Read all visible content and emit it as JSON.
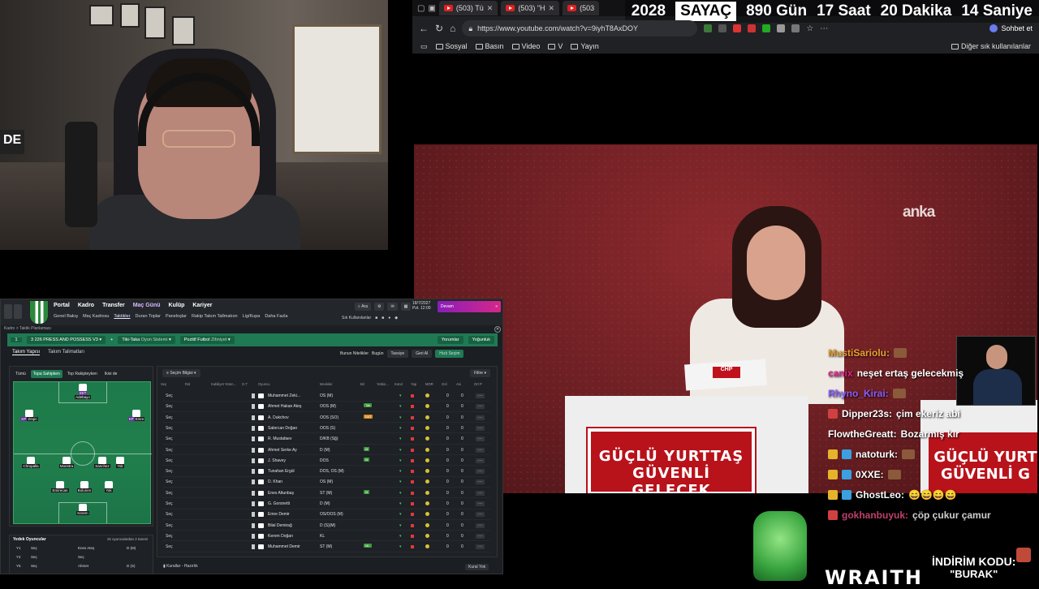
{
  "browser": {
    "tabs": [
      {
        "title": "(503) Tü"
      },
      {
        "title": "(503) \"H"
      },
      {
        "title": "(503"
      }
    ],
    "url": "https://www.youtube.com/watch?v=9iyhT8AxDOY",
    "bookmarks": [
      "Sosyal",
      "Basın",
      "Video",
      "V",
      "Yayın"
    ],
    "other_bookmarks": "Diğer sık kullanılanlar",
    "chat_button": "Sohbet et"
  },
  "counter": {
    "year": "2028",
    "label": "SAYAÇ",
    "days": "890 Gün",
    "hours": "17 Saat",
    "minutes": "20 Dakika",
    "seconds": "14 Saniye"
  },
  "webcam": {
    "corner_text": "DE"
  },
  "video": {
    "watermark": "anka",
    "podium_line1": "GÜÇLÜ YURTTAŞ",
    "podium_line2": "GÜVENLİ GELECEK",
    "podium2_line1": "GÜÇLÜ YURT",
    "podium2_line2": "GÜVENLİ G",
    "paper_logo": "CHP"
  },
  "chat": {
    "messages": [
      {
        "user": "MustiSariolu:",
        "text": "",
        "color": "#e8a030"
      },
      {
        "user": "canix",
        "text": "neşet ertaş gelecekmiş",
        "color": "#e0208a"
      },
      {
        "user": "Rhyno_Kirai:",
        "text": "",
        "color": "#8a5cff"
      },
      {
        "user": "Dipper23s:",
        "text": "çim ekeriz abi",
        "color": "#ffffff"
      },
      {
        "user": "FlowtheGreatt:",
        "text": "Bozarmış kır",
        "color": "#ffffff"
      },
      {
        "user": "natoturk:",
        "text": "",
        "color": "#ffffff"
      },
      {
        "user": "0XXE:",
        "text": "",
        "color": "#ffffff"
      },
      {
        "user": "GhostLeo:",
        "text": "😄😄😄😄",
        "color": "#ffffff"
      },
      {
        "user": "gokhanbuyuk:",
        "text": "çöp çukur çamur",
        "color": "#c0406a"
      }
    ]
  },
  "overlay": {
    "brand": "WRAITH",
    "promo_line": "İNDİRİM KODU:",
    "promo_code": "\"BURAK\""
  },
  "fm": {
    "menu": [
      "Portal",
      "Kadro",
      "Transfer",
      "Maç Günü",
      "Kulüp",
      "Kariyer"
    ],
    "submenu": [
      "Genel Bakış",
      "Maç Kadrosu",
      "Taktikler",
      "Duran Toplar",
      "Paneloşlar",
      "Rakip Takım Tallmatıon",
      "Lig/Kupa",
      "Daha Fazla"
    ],
    "search_btn": "Ara",
    "date_line1": "18/7/2027",
    "date_line2": "Pzt. 12:00",
    "continue_label": "Devam",
    "top_icons": "Sık Kullanılanlar",
    "breadcrumb": "Kadro > Taktik Planlaması",
    "tactic_number": "1",
    "tactic_name": "3 226 PRESS AND POSSESS V3",
    "tactic_style": "Tiki-Taka",
    "tactic_style_sub": "Oyun Sistemi",
    "tactic_mentality": "Pozitif Futbol",
    "tactic_mentality_sub": "Zihniyet",
    "tactic_right1": "Yorumlar",
    "tactic_right2": "Yoğunluk",
    "tabs": [
      "Takım Yapısı",
      "Takım Talimatları"
    ],
    "actions": [
      "Bunun Nitelikler",
      "Bugün",
      "Tavsiye",
      "Geri Al",
      "Hızlı Seçim"
    ],
    "pitch_tabs": [
      "Tümü",
      "Topa Sahipken",
      "Top Rakipteyken",
      "Ikisi de"
    ],
    "players": [
      {
        "name": "Adebayo",
        "role": "SKT"
      },
      {
        "name": "Zeqiri",
        "role": "KP"
      },
      {
        "name": "Emre",
        "role": "KP"
      },
      {
        "name": "Chrupalla",
        "role": ""
      },
      {
        "name": "Moestra",
        "role": ""
      },
      {
        "name": "Sanchez",
        "role": ""
      },
      {
        "name": "Yok",
        "role": ""
      },
      {
        "name": "Emirecan",
        "role": ""
      },
      {
        "name": "Bolunen",
        "role": ""
      },
      {
        "name": "Yok",
        "role": ""
      },
      {
        "name": "Kerem",
        "role": ""
      }
    ],
    "squad_filter": "Seçim Bilgisi",
    "squad_filter_btn": "Filtre",
    "squad_headers": [
      "Seç",
      "Rol",
      "Kabiliyet Yeten...",
      "G.T",
      "Oyuncu",
      "Mevkiler",
      "Bil",
      "Yetkin...",
      "Kond",
      "Yap",
      "MOR",
      "Gol",
      "Asi",
      "Ort P"
    ],
    "rows": [
      {
        "sec": "Seç",
        "name": "Muhammet Zeki...",
        "pos": "OS (M)",
        "tag": "",
        "tagc": "",
        "n1": "0",
        "n2": "0"
      },
      {
        "sec": "Seç",
        "name": "Ahmet Hakan Ateş",
        "pos": "OOS (M)",
        "tag": "Tak",
        "tagc": "#3a9a3a",
        "n1": "0",
        "n2": "0"
      },
      {
        "sec": "Seç",
        "name": "A. Dukchov",
        "pos": "OOS (SO)",
        "tag": "SAT",
        "tagc": "#d28a1a",
        "n1": "0",
        "n2": "0"
      },
      {
        "sec": "Seç",
        "name": "Sabırcan Doğan",
        "pos": "OOS (S)",
        "tag": "",
        "tagc": "",
        "n1": "0",
        "n2": "0"
      },
      {
        "sec": "Seç",
        "name": "R. Mustafaev",
        "pos": "D/KB (Sğ)",
        "tag": "",
        "tagc": "",
        "n1": "0",
        "n2": "0"
      },
      {
        "sec": "Seç",
        "name": "Ahmet Serke Ay",
        "pos": "D (M)",
        "tag": "M",
        "tagc": "#3a9a3a",
        "n1": "0",
        "n2": "0"
      },
      {
        "sec": "Seç",
        "name": "J. Shavey",
        "pos": "DOS",
        "tag": "M",
        "tagc": "#3a9a3a",
        "n1": "0",
        "n2": "0"
      },
      {
        "sec": "Seç",
        "name": "Tunahan Ergül",
        "pos": "DOS, OS (M)",
        "tag": "",
        "tagc": "",
        "n1": "0",
        "n2": "0"
      },
      {
        "sec": "Seç",
        "name": "D. Khan",
        "pos": "OS (M)",
        "tag": "",
        "tagc": "",
        "n1": "0",
        "n2": "0"
      },
      {
        "sec": "Seç",
        "name": "Enes Altunbaş",
        "pos": "ST (M)",
        "tag": "M",
        "tagc": "#3a9a3a",
        "n1": "0",
        "n2": "0"
      },
      {
        "sec": "Seç",
        "name": "G. Gorsnetti",
        "pos": "D (M)",
        "tag": "",
        "tagc": "",
        "n1": "0",
        "n2": "0"
      },
      {
        "sec": "Seç",
        "name": "Emre Demir",
        "pos": "OS/OOS (M)",
        "tag": "",
        "tagc": "",
        "n1": "0",
        "n2": "0"
      },
      {
        "sec": "Seç",
        "name": "Bilal Demirağ",
        "pos": "D (S)(M)",
        "tag": "",
        "tagc": "",
        "n1": "0",
        "n2": "0"
      },
      {
        "sec": "Seç",
        "name": "Kerem Doğan",
        "pos": "KL",
        "tag": "",
        "tagc": "",
        "n1": "0",
        "n2": "0"
      },
      {
        "sec": "Seç",
        "name": "Muhammet Demir",
        "pos": "ST (M)",
        "tag": "ML",
        "tagc": "#3a9a3a",
        "n1": "0",
        "n2": "0"
      }
    ],
    "subs_title": "Yedek Oyuncular",
    "subs_note": "15 oyunculardan 2 tanesi",
    "subs": [
      {
        "k": "Y1",
        "a": "Seç",
        "b": "Enes Ateş",
        "c": "D (M)"
      },
      {
        "k": "Y4",
        "a": "Seç",
        "b": "Seç",
        "c": ""
      },
      {
        "k": "Y5",
        "a": "Seç",
        "b": "Ahmet",
        "c": "D (S)"
      }
    ],
    "footer_left": "Kurallar - Hazırlık",
    "footer_right": "Kural Yok"
  }
}
